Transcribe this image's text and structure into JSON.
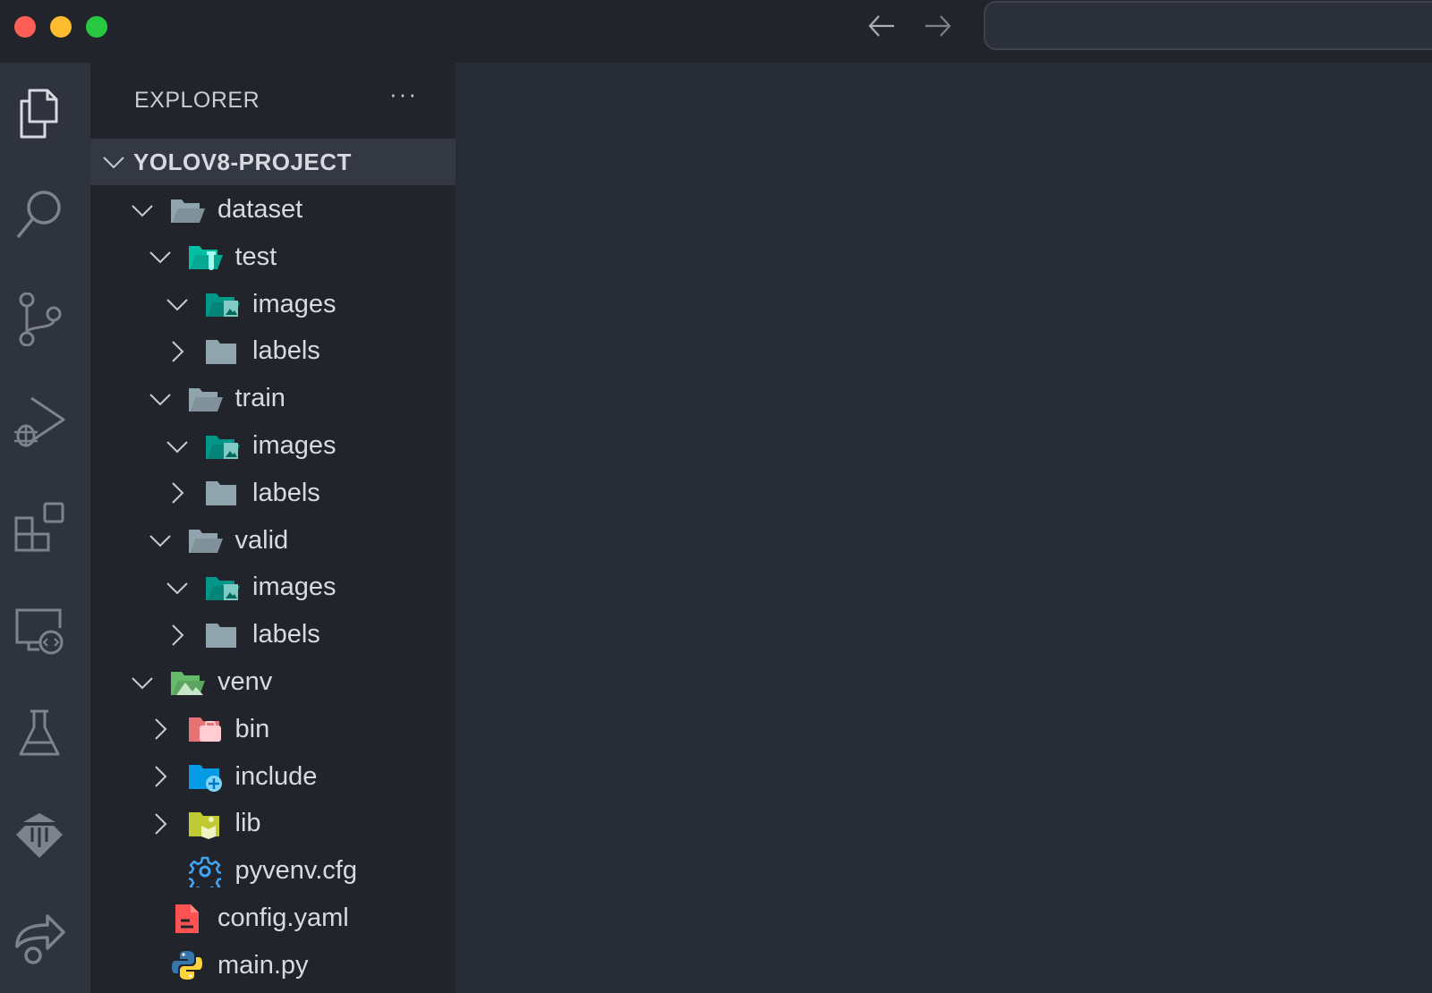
{
  "window": {
    "controls": [
      "close",
      "minimize",
      "maximize"
    ]
  },
  "titlebar": {
    "back_icon": "arrow-left-icon",
    "forward_icon": "arrow-right-icon"
  },
  "activity_bar": [
    "explorer",
    "search",
    "source-control",
    "run-and-debug",
    "extensions",
    "remote-explorer",
    "testing",
    "custom-extension",
    "live-share"
  ],
  "sidebar": {
    "title": "EXPLORER",
    "more_label": "···",
    "project": "YOLOV8-PROJECT",
    "tree": [
      {
        "label": "dataset",
        "depth": 0,
        "type": "folder",
        "expanded": true,
        "icon": "folder-open",
        "color": "#90a4ae"
      },
      {
        "label": "test",
        "depth": 1,
        "type": "folder",
        "expanded": true,
        "icon": "folder-test",
        "color": "#00bfa5"
      },
      {
        "label": "images",
        "depth": 2,
        "type": "folder",
        "expanded": true,
        "icon": "folder-images",
        "color": "#009688"
      },
      {
        "label": "labels",
        "depth": 2,
        "type": "folder",
        "expanded": false,
        "icon": "folder",
        "color": "#90a4ae"
      },
      {
        "label": "train",
        "depth": 1,
        "type": "folder",
        "expanded": true,
        "icon": "folder-open",
        "color": "#90a4ae"
      },
      {
        "label": "images",
        "depth": 2,
        "type": "folder",
        "expanded": true,
        "icon": "folder-images",
        "color": "#009688"
      },
      {
        "label": "labels",
        "depth": 2,
        "type": "folder",
        "expanded": false,
        "icon": "folder",
        "color": "#90a4ae"
      },
      {
        "label": "valid",
        "depth": 1,
        "type": "folder",
        "expanded": true,
        "icon": "folder-open",
        "color": "#90a4ae"
      },
      {
        "label": "images",
        "depth": 2,
        "type": "folder",
        "expanded": true,
        "icon": "folder-images",
        "color": "#009688"
      },
      {
        "label": "labels",
        "depth": 2,
        "type": "folder",
        "expanded": false,
        "icon": "folder",
        "color": "#90a4ae"
      },
      {
        "label": "venv",
        "depth": 0,
        "type": "folder",
        "expanded": true,
        "icon": "folder-venv",
        "color": "#66bb6a"
      },
      {
        "label": "bin",
        "depth": 1,
        "type": "folder",
        "expanded": false,
        "icon": "folder-bin",
        "color": "#e57373"
      },
      {
        "label": "include",
        "depth": 1,
        "type": "folder",
        "expanded": false,
        "icon": "folder-include",
        "color": "#039be5"
      },
      {
        "label": "lib",
        "depth": 1,
        "type": "folder",
        "expanded": false,
        "icon": "folder-lib",
        "color": "#c0ca33"
      },
      {
        "label": "pyvenv.cfg",
        "depth": 1,
        "type": "file",
        "icon": "gear",
        "color": "#42a5f5"
      },
      {
        "label": "config.yaml",
        "depth": 0,
        "type": "file",
        "icon": "yaml-file",
        "color": "#ff5252"
      },
      {
        "label": "main.py",
        "depth": 0,
        "type": "file",
        "icon": "python",
        "color": "#3776ab"
      }
    ]
  }
}
